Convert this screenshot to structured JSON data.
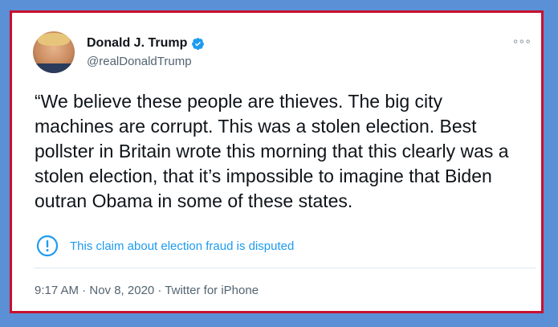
{
  "tweet": {
    "display_name": "Donald J. Trump",
    "handle": "@realDonaldTrump",
    "more_label": "∘∘∘",
    "text": "“We believe these people are thieves. The big city machines are corrupt. This was a stolen election. Best pollster in Britain wrote this morning that this clearly was a stolen election, that it’s impossible to imagine that Biden outran Obama in some of these states.",
    "disputed_label": "This claim about election fraud is disputed",
    "meta": "9:17 AM · Nov 8, 2020 · Twitter for iPhone"
  },
  "icons": {
    "avatar": "profile-photo",
    "verified": "verified-badge-icon",
    "disputed": "exclamation-circle-icon",
    "more": "more-options-icon"
  },
  "colors": {
    "background": "#5b8fd6",
    "frame": "#c8102e",
    "link_blue": "#1d9bf0",
    "secondary_text": "#536471",
    "primary_text": "#0f1419"
  }
}
